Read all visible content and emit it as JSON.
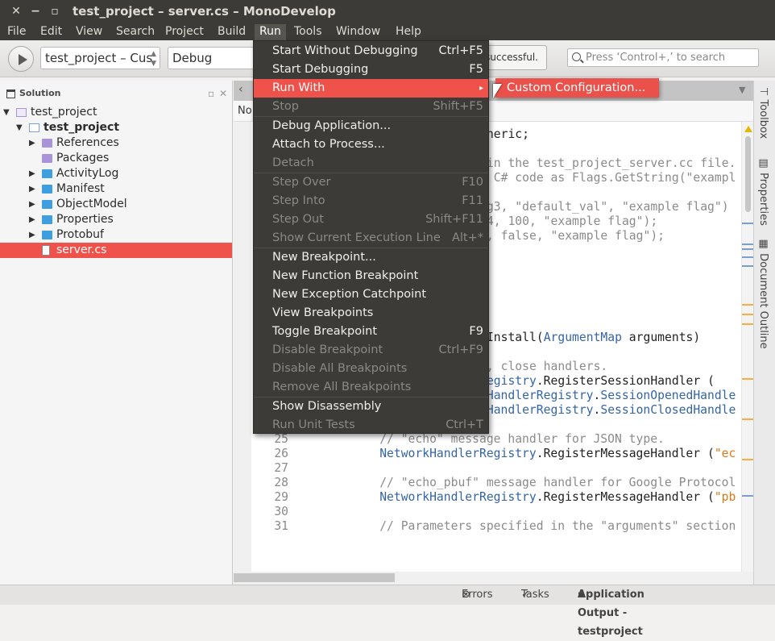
{
  "window": {
    "title": "test_project – server.cs – MonoDevelop"
  },
  "menubar": [
    {
      "label": "File"
    },
    {
      "label": "Edit"
    },
    {
      "label": "View"
    },
    {
      "label": "Search"
    },
    {
      "label": "Project"
    },
    {
      "label": "Build"
    },
    {
      "label": "Run",
      "active": true
    },
    {
      "label": "Tools"
    },
    {
      "label": "Window"
    },
    {
      "label": "Help"
    }
  ],
  "toolbar": {
    "project_combo": "test_project – Cus",
    "config_combo": "Debug",
    "status_text": "successful.",
    "search_placeholder": "Press ‘Control+,’ to search"
  },
  "solution": {
    "title": "Solution",
    "items": [
      {
        "label": "test_project",
        "icon": "solution-icon",
        "expanded": true
      },
      {
        "label": "test_project",
        "icon": "project-icon",
        "expanded": true,
        "bold": true
      },
      {
        "label": "References",
        "icon": "package-folder-icon",
        "expanded": false
      },
      {
        "label": "Packages",
        "icon": "package-folder-icon"
      },
      {
        "label": "ActivityLog",
        "icon": "folder-icon",
        "expanded": false
      },
      {
        "label": "Manifest",
        "icon": "folder-icon",
        "expanded": false
      },
      {
        "label": "ObjectModel",
        "icon": "folder-icon",
        "expanded": false
      },
      {
        "label": "Properties",
        "icon": "folder-icon",
        "expanded": false
      },
      {
        "label": "Protobuf",
        "icon": "folder-icon",
        "expanded": false
      },
      {
        "label": "server.cs",
        "icon": "file-icon",
        "selected": true
      }
    ]
  },
  "editor": {
    "path_fragment": "No",
    "lines": [
      {
        "row": 4,
        "num": "",
        "col": 27,
        "tokens": [
          [
            "neric;",
            "plain"
          ]
        ]
      },
      {
        "row": 6,
        "num": "",
        "col": 27,
        "tokens": [
          [
            "in the test_project_server.cc file.",
            "comment"
          ]
        ]
      },
      {
        "row": 7,
        "num": "",
        "col": 27,
        "tokens": [
          [
            " C# code as Flags.GetString(\"exampl",
            "comment"
          ]
        ]
      },
      {
        "row": 9,
        "num": "",
        "col": 27,
        "tokens": [
          [
            "g3, \"default_val\", \"example flag\")",
            "comment"
          ]
        ]
      },
      {
        "row": 10,
        "num": "",
        "col": 27,
        "tokens": [
          [
            "4, 100, \"example flag\");",
            "comment"
          ]
        ]
      },
      {
        "row": 11,
        "num": "",
        "col": 27,
        "tokens": [
          [
            ", false, \"example flag\");",
            "comment"
          ]
        ]
      },
      {
        "row": 18,
        "num": "",
        "col": 27,
        "tokens": [
          [
            "Install(",
            "plain"
          ],
          [
            "ArgumentMap",
            "type"
          ],
          [
            " arguments)",
            "plain"
          ]
        ]
      },
      {
        "row": 20,
        "num": "",
        "col": 27,
        "tokens": [
          [
            ", close handlers.",
            "comment"
          ]
        ]
      },
      {
        "row": 21,
        "num": "",
        "col": 27,
        "tokens": [
          [
            "egistry",
            "type"
          ],
          [
            ".RegisterSessionHandler (",
            "plain"
          ]
        ]
      },
      {
        "row": 22,
        "num": "22",
        "col": 16,
        "tokens": [
          [
            "new",
            "keyword"
          ],
          [
            " NetworkHandlerRegistry",
            "type"
          ],
          [
            ".",
            "plain"
          ],
          [
            "SessionOpenedHandle",
            "type"
          ]
        ]
      },
      {
        "row": 23,
        "num": "23",
        "col": 16,
        "tokens": [
          [
            "new",
            "keyword"
          ],
          [
            " NetworkHandlerRegistry",
            "type"
          ],
          [
            ".",
            "plain"
          ],
          [
            "SessionClosedHandle",
            "type"
          ]
        ]
      },
      {
        "row": 24,
        "num": "24",
        "col": 0,
        "tokens": []
      },
      {
        "row": 25,
        "num": "25",
        "col": 12,
        "tokens": [
          [
            "// \"echo\" message handler for JSON type.",
            "comment"
          ]
        ]
      },
      {
        "row": 26,
        "num": "26",
        "col": 12,
        "tokens": [
          [
            "NetworkHandlerRegistry",
            "type"
          ],
          [
            ".RegisterMessageHandler (",
            "plain"
          ],
          [
            "\"ec",
            "string"
          ]
        ]
      },
      {
        "row": 27,
        "num": "27",
        "col": 0,
        "tokens": []
      },
      {
        "row": 28,
        "num": "28",
        "col": 12,
        "tokens": [
          [
            "// \"echo_pbuf\" message handler for Google Protocol",
            "comment"
          ]
        ]
      },
      {
        "row": 29,
        "num": "29",
        "col": 12,
        "tokens": [
          [
            "NetworkHandlerRegistry",
            "type"
          ],
          [
            ".RegisterMessageHandler (",
            "plain"
          ],
          [
            "\"pb",
            "string"
          ]
        ]
      },
      {
        "row": 30,
        "num": "30",
        "col": 0,
        "tokens": []
      },
      {
        "row": 31,
        "num": "31",
        "col": 12,
        "tokens": [
          [
            "// Parameters specified in the \"arguments\" section",
            "comment"
          ]
        ]
      }
    ]
  },
  "right_pads": [
    {
      "label": "Toolbox"
    },
    {
      "label": "Properties"
    },
    {
      "label": "Document Outline"
    }
  ],
  "statusbar": {
    "errors": "Errors",
    "tasks": "Tasks",
    "output": "Application Output - testproject"
  },
  "run_menu": [
    {
      "label": "Start Without Debugging",
      "shortcut": "Ctrl+F5"
    },
    {
      "label": "Start Debugging",
      "shortcut": "F5"
    },
    {
      "label": "Run With",
      "submenu": true,
      "highlighted": true
    },
    {
      "label": "Stop",
      "shortcut": "Shift+F5",
      "disabled": true
    },
    {
      "separator": true
    },
    {
      "label": "Debug Application..."
    },
    {
      "label": "Attach to Process..."
    },
    {
      "label": "Detach",
      "disabled": true
    },
    {
      "separator": true
    },
    {
      "label": "Step Over",
      "shortcut": "F10",
      "disabled": true
    },
    {
      "label": "Step Into",
      "shortcut": "F11",
      "disabled": true
    },
    {
      "label": "Step Out",
      "shortcut": "Shift+F11",
      "disabled": true
    },
    {
      "label": "Show Current Execution Line",
      "shortcut": "Alt+*",
      "disabled": true
    },
    {
      "separator": true
    },
    {
      "label": "New Breakpoint..."
    },
    {
      "label": "New Function Breakpoint"
    },
    {
      "label": "New Exception Catchpoint"
    },
    {
      "label": "View Breakpoints"
    },
    {
      "label": "Toggle Breakpoint",
      "shortcut": "F9"
    },
    {
      "label": "Disable Breakpoint",
      "shortcut": "Ctrl+F9",
      "disabled": true
    },
    {
      "label": "Disable All Breakpoints",
      "disabled": true
    },
    {
      "label": "Remove All Breakpoints",
      "disabled": true
    },
    {
      "separator": true
    },
    {
      "label": "Show Disassembly"
    },
    {
      "label": "Run Unit Tests",
      "shortcut": "Ctrl+T",
      "disabled": true
    }
  ],
  "submenu": {
    "label": "Custom Configuration..."
  },
  "colors": {
    "accent": "#ee524a",
    "menu_bg": "#3c3b37",
    "type": "#3465a4",
    "comment": "#8b8b8b",
    "string": "#d97a13",
    "keyword": "#009695"
  }
}
